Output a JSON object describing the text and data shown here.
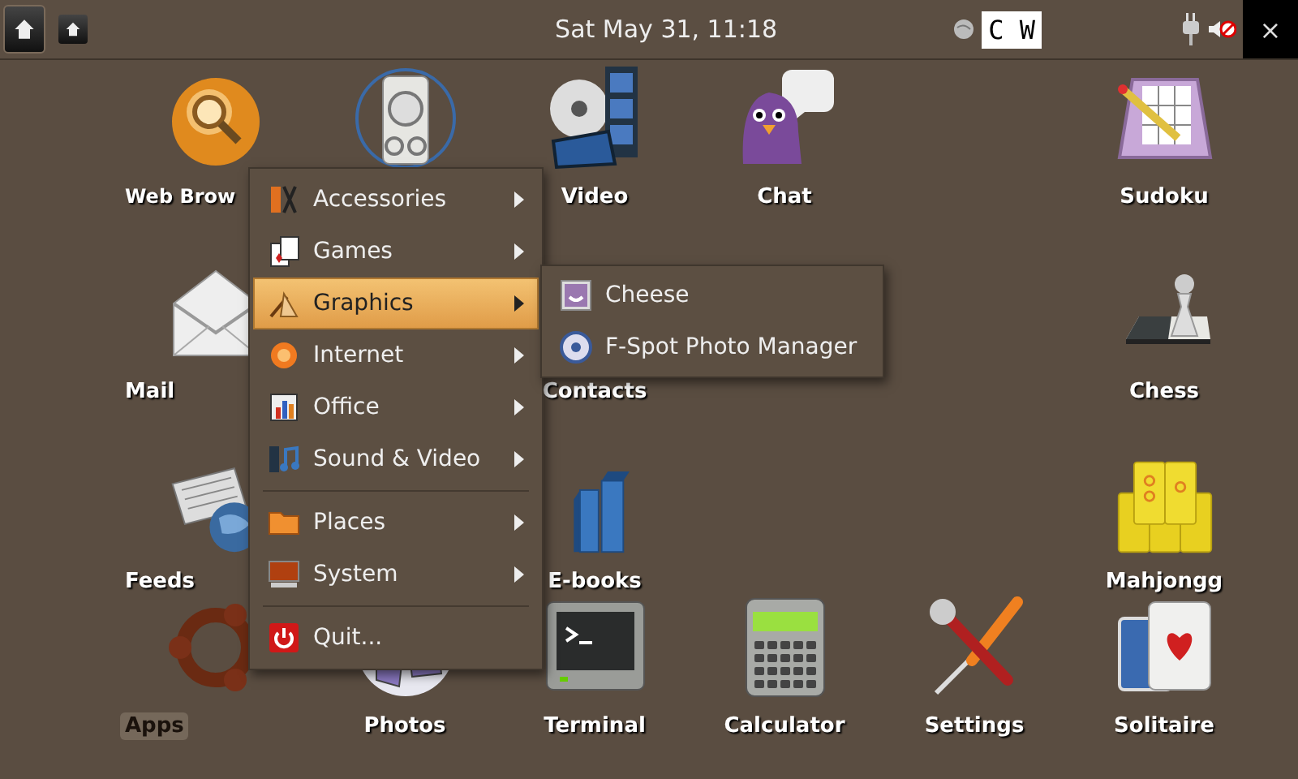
{
  "top_bar": {
    "clock": "Sat May 31, 11:18",
    "keyboard_indicator": "C W",
    "close_button": "×"
  },
  "desktop": {
    "rows": [
      [
        {
          "label": "Web Brow",
          "kind": "globe",
          "selected": false
        },
        {
          "kind": "speaker"
        },
        {
          "label": "Video",
          "kind": "film",
          "selected": false
        },
        {
          "label": "Chat",
          "kind": "bird",
          "selected": false
        },
        null,
        {
          "label": "Sudoku",
          "kind": "sudoku",
          "selected": false
        }
      ],
      [
        {
          "label": "Mail",
          "kind": "envelope",
          "selected": false
        },
        null,
        {
          "label": "Contacts",
          "kind": "hidden",
          "selected": false
        },
        null,
        null,
        {
          "label": "Chess",
          "kind": "chess",
          "selected": false
        }
      ],
      [
        {
          "label": "Feeds",
          "kind": "news",
          "selected": false
        },
        null,
        {
          "label": "E-books",
          "kind": "books",
          "selected": false
        },
        null,
        null,
        {
          "label": "Mahjongg",
          "kind": "mahjong",
          "selected": false
        }
      ],
      [
        {
          "label": "Apps",
          "kind": "ubuntu",
          "selected": true
        },
        {
          "label": "Photos",
          "kind": "photos",
          "selected": false
        },
        {
          "label": "Terminal",
          "kind": "terminal",
          "selected": false
        },
        {
          "label": "Calculator",
          "kind": "calculator",
          "selected": false
        },
        {
          "label": "Settings",
          "kind": "tools",
          "selected": false
        },
        {
          "label": "Solitaire",
          "kind": "cards",
          "selected": false
        }
      ]
    ]
  },
  "menu": {
    "sections": [
      [
        {
          "label": "Accessories",
          "kind": "accessories",
          "submenu": true,
          "selected": false
        },
        {
          "label": "Games",
          "kind": "games",
          "submenu": true,
          "selected": false
        },
        {
          "label": "Graphics",
          "kind": "graphics",
          "submenu": true,
          "selected": true
        },
        {
          "label": "Internet",
          "kind": "internet",
          "submenu": true,
          "selected": false
        },
        {
          "label": "Office",
          "kind": "office",
          "submenu": true,
          "selected": false
        },
        {
          "label": "Sound & Video",
          "kind": "sound",
          "submenu": true,
          "selected": false
        }
      ],
      [
        {
          "label": "Places",
          "kind": "folder",
          "submenu": true,
          "selected": false
        },
        {
          "label": "System",
          "kind": "system",
          "submenu": true,
          "selected": false
        }
      ],
      [
        {
          "label": "Quit...",
          "kind": "quit",
          "submenu": false,
          "selected": false
        }
      ]
    ]
  },
  "submenu": {
    "items": [
      {
        "label": "Cheese",
        "kind": "cheese"
      },
      {
        "label": "F-Spot Photo Manager",
        "kind": "fspot"
      }
    ]
  }
}
